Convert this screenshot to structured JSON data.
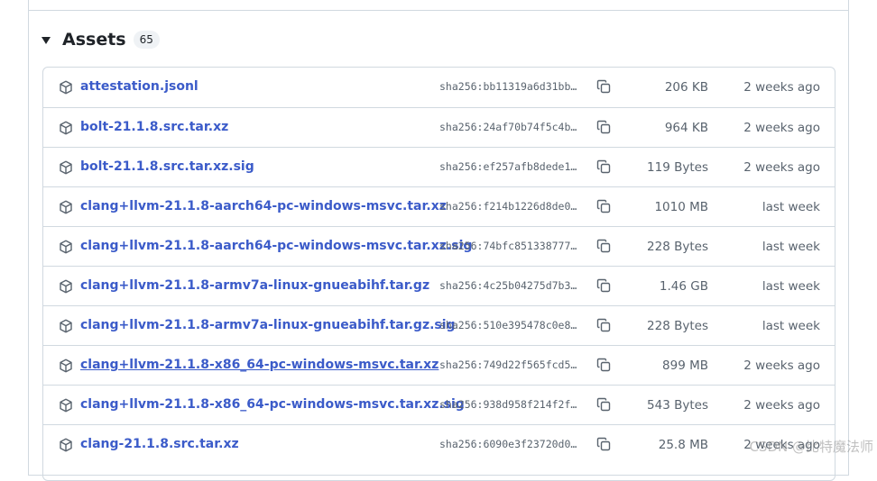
{
  "section": {
    "title": "Assets",
    "count": "65"
  },
  "assets": [
    {
      "name": "attestation.jsonl",
      "sha": "sha256:bb11319a6d31bb…",
      "size": "206 KB",
      "date": "2 weeks ago"
    },
    {
      "name": "bolt-21.1.8.src.tar.xz",
      "sha": "sha256:24af70b74f5c4b…",
      "size": "964 KB",
      "date": "2 weeks ago"
    },
    {
      "name": "bolt-21.1.8.src.tar.xz.sig",
      "sha": "sha256:ef257afb8dede1…",
      "size": "119 Bytes",
      "date": "2 weeks ago"
    },
    {
      "name": "clang+llvm-21.1.8-aarch64-pc-windows-msvc.tar.xz",
      "sha": "sha256:f214b1226d8de0…",
      "size": "1010 MB",
      "date": "last week"
    },
    {
      "name": "clang+llvm-21.1.8-aarch64-pc-windows-msvc.tar.xz.sig",
      "sha": "sha256:74bfc851338777…",
      "size": "228 Bytes",
      "date": "last week"
    },
    {
      "name": "clang+llvm-21.1.8-armv7a-linux-gnueabihf.tar.gz",
      "sha": "sha256:4c25b04275d7b3…",
      "size": "1.46 GB",
      "date": "last week"
    },
    {
      "name": "clang+llvm-21.1.8-armv7a-linux-gnueabihf.tar.gz.sig",
      "sha": "sha256:510e395478c0e8…",
      "size": "228 Bytes",
      "date": "last week"
    },
    {
      "name": "clang+llvm-21.1.8-x86_64-pc-windows-msvc.tar.xz",
      "sha": "sha256:749d22f565fcd5…",
      "size": "899 MB",
      "date": "2 weeks ago",
      "hovered": true
    },
    {
      "name": "clang+llvm-21.1.8-x86_64-pc-windows-msvc.tar.xz.sig",
      "sha": "sha256:938d958f214f2f…",
      "size": "543 Bytes",
      "date": "2 weeks ago"
    },
    {
      "name": "clang-21.1.8.src.tar.xz",
      "sha": "sha256:6090e3f23720d0…",
      "size": "25.8 MB",
      "date": "2 weeks ago"
    }
  ],
  "icons": {
    "package": "package-icon",
    "copy": "copy-icon",
    "triangle": "triangle-down-icon"
  },
  "colors": {
    "link": "#3b5bc9",
    "muted": "#59636e",
    "border": "#d1d9e0"
  },
  "watermark": "CSDN @比特魔法师"
}
